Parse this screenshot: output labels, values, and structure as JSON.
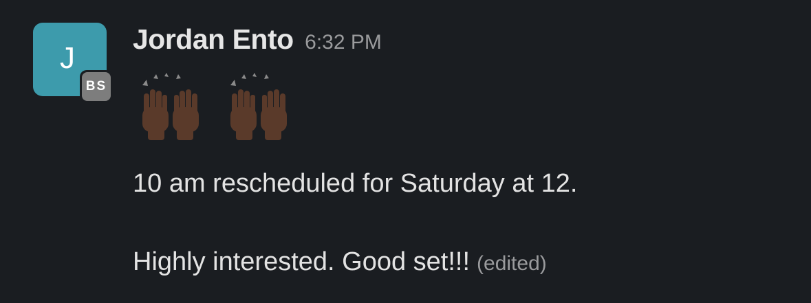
{
  "message": {
    "avatar_initial": "J",
    "org_badge": "BS",
    "sender": "Jordan Ento",
    "timestamp": "6:32 PM",
    "emoji": [
      "raising-hands",
      "raising-hands"
    ],
    "lines": [
      "10 am rescheduled for Saturday at 12.",
      "Highly interested. Good set!!!"
    ],
    "edited_label": "(edited)"
  },
  "colors": {
    "background": "#1a1d21",
    "avatar": "#3d9bac",
    "badge": "#7d7d7d",
    "text": "#e3e3e3",
    "muted": "#9a9b9d",
    "skin": "#5a3a2a"
  }
}
